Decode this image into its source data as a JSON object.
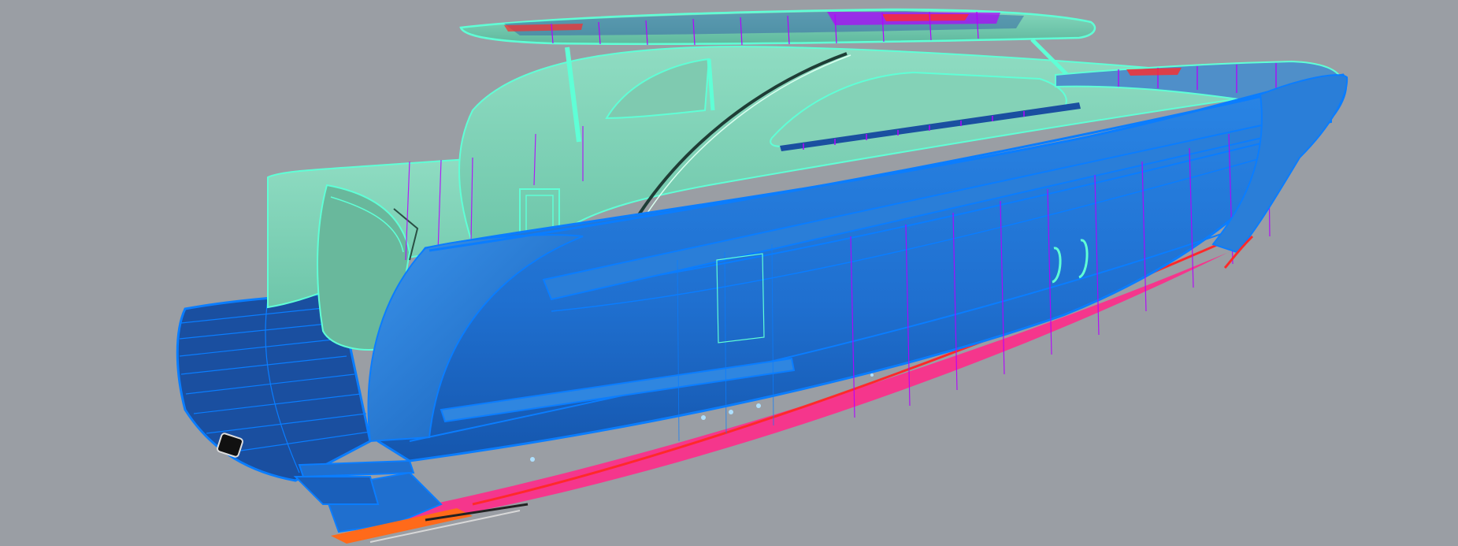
{
  "viewport": {
    "background": "#9a9ea4",
    "display_mode": "zebra-curvature-analysis"
  },
  "model": {
    "subject": "motor-yacht-hull",
    "colors": {
      "hull": "#1f6fcf",
      "hull_edge": "#0a7dff",
      "superstructure": "#7fd1b6",
      "superstructure_edge": "#5fffd6",
      "deck": "#1a4fa0",
      "isoline_magenta": "#b400ff",
      "isoline_red": "#ff2a2a",
      "keel_highlight": "#ff2a8a",
      "running_gear": "#ff6a1a"
    }
  }
}
